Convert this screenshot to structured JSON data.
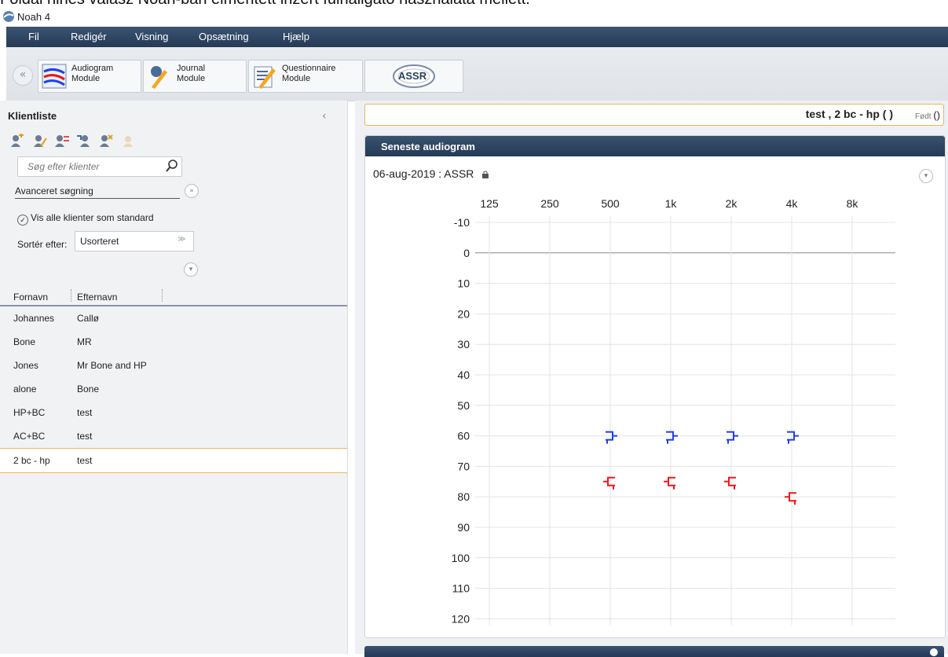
{
  "caption": "Foldal hines válasz Noah-ban elmentett inzert fülhallgató használata mellett.",
  "window": {
    "title": "Noah 4"
  },
  "menu": [
    "Fil",
    "Redigér",
    "Visning",
    "Opsætning",
    "Hjælp"
  ],
  "modules": [
    {
      "label": "Audiogram\nModule",
      "icon": "audiogram-module-icon"
    },
    {
      "label": "Journal\nModule",
      "icon": "journal-module-icon"
    },
    {
      "label": "Questionnaire\nModule",
      "icon": "questionnaire-module-icon"
    },
    {
      "label": "ASSR",
      "icon": "assr-module-icon"
    }
  ],
  "client_list": {
    "title": "Klientliste",
    "tool_icons": [
      "add-client-icon",
      "edit-client-icon",
      "merge-client-icon",
      "move-client-icon",
      "delete-client-icon",
      "settings-client-icon"
    ],
    "search_placeholder": "Søg efter klienter",
    "advanced_search": "Avanceret søgning",
    "show_all_label": "Vis alle klienter som standard",
    "show_all_checked": true,
    "sort_label": "Sortér efter:",
    "sort_value": "Usorteret",
    "columns": [
      "Fornavn",
      "Efternavn"
    ],
    "rows": [
      {
        "first": "Johannes",
        "last": "Callø"
      },
      {
        "first": "Bone",
        "last": "MR"
      },
      {
        "first": "Jones",
        "last": "Mr Bone and HP"
      },
      {
        "first": "alone",
        "last": "Bone"
      },
      {
        "first": "HP+BC",
        "last": "test"
      },
      {
        "first": "AC+BC",
        "last": "test"
      },
      {
        "first": "2 bc - hp",
        "last": "test"
      }
    ],
    "selected_index": 6
  },
  "patient": {
    "name": "test , 2 bc - hp  (  )",
    "born_label": "Født",
    "born_value": "()"
  },
  "audiogram_card": {
    "title": "Seneste audiogram",
    "session": "06-aug-2019 : ASSR"
  },
  "chart_data": {
    "type": "scatter",
    "x_ticks": [
      "125",
      "250",
      "500",
      "1k",
      "2k",
      "4k",
      "8k"
    ],
    "y_ticks": [
      -10,
      0,
      10,
      20,
      30,
      40,
      50,
      60,
      70,
      80,
      90,
      100,
      110,
      120
    ],
    "ylim": [
      -10,
      120
    ],
    "y_inverted": true,
    "series": [
      {
        "symbol": "bc-left-masked",
        "color": "#1f3ff0",
        "points": [
          {
            "x": "500",
            "y": 60
          },
          {
            "x": "1k",
            "y": 60
          },
          {
            "x": "2k",
            "y": 60
          },
          {
            "x": "4k",
            "y": 60
          }
        ]
      },
      {
        "symbol": "bc-right-masked",
        "color": "#f01818",
        "points": [
          {
            "x": "500",
            "y": 75
          },
          {
            "x": "1k",
            "y": 75
          },
          {
            "x": "2k",
            "y": 75
          },
          {
            "x": "4k",
            "y": 80
          }
        ]
      }
    ]
  }
}
